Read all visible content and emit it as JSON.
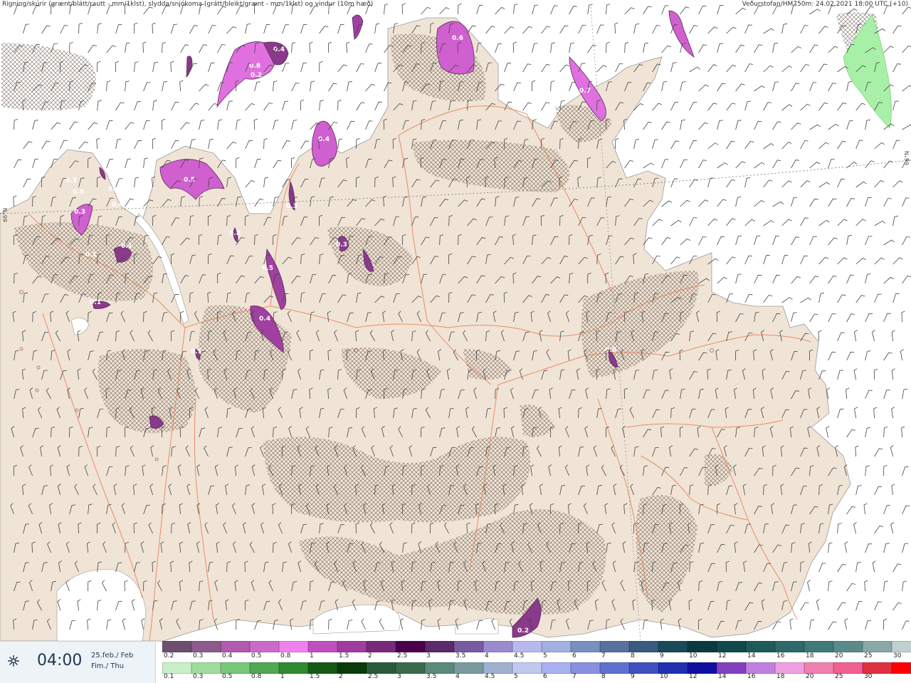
{
  "header": {
    "left": "Rigning/skúrir (grænt/blátt/rautt - mm/1klst), slydda/snjókoma (grátt/bleikt/grænt - mm/1klst) og vindur (10m hæð)",
    "right": "Veðurstofan/HM750m: 24.02.2021 18:00 UTC (+10)"
  },
  "lat_labels": [
    "66°N",
    "66°N"
  ],
  "time": {
    "value": "04:00",
    "date": "25.feb./ Feb",
    "day": "Fim./ Thu",
    "icon": "weather-station-icon"
  },
  "precip_values": [
    "0.8",
    "0.2",
    "0.4",
    "0.6",
    "0.7",
    "0.3",
    "0.5",
    "0.8",
    "0.6",
    "0.4",
    "0.4",
    "0.5",
    "0.3",
    "0.3",
    "0.1",
    "0.5",
    "0.4",
    "0.3",
    "0.1",
    "0.1",
    "0.5",
    "0.2",
    "0.1"
  ],
  "legend": {
    "snow_labels": [
      "0.2",
      "0.3",
      "0.4",
      "0.5",
      "0.8",
      "1",
      "1.5",
      "2",
      "2.5",
      "3",
      "3.5",
      "4",
      "4.5",
      "5",
      "6",
      "7",
      "8",
      "9",
      "10",
      "12",
      "14",
      "16",
      "18",
      "20",
      "25",
      "30"
    ],
    "snow_colors": [
      "#6e4e6e",
      "#8c5a8c",
      "#b05ab0",
      "#cc6acc",
      "#f080f0",
      "#c050c0",
      "#a03ca0",
      "#7a2a7a",
      "#4a004a",
      "#5a2a6a",
      "#7a5aa0",
      "#9a8ad0",
      "#b8b8f0",
      "#a0b0e0",
      "#7890c0",
      "#5a70a0",
      "#3a5a80",
      "#1a4a5a",
      "#0a3a40",
      "#0f4a4a",
      "#1e5a5a",
      "#2e6a6a",
      "#3e7a7a",
      "#5a8a8a",
      "#8aa8a8",
      "#c0cfcf",
      "#ffffff"
    ],
    "rain_labels": [
      "0.1",
      "0.3",
      "0.5",
      "0.8",
      "1",
      "1.5",
      "2",
      "2.5",
      "3",
      "3.5",
      "4",
      "4.5",
      "5",
      "6",
      "7",
      "8",
      "9",
      "10",
      "12",
      "14",
      "16",
      "18",
      "20",
      "25",
      "30"
    ],
    "rain_colors": [
      "#c8f0c8",
      "#a0dca0",
      "#78c878",
      "#50a850",
      "#2e8a2e",
      "#145a14",
      "#0a3a0a",
      "#2a5a3a",
      "#3a6a4a",
      "#5a8a7a",
      "#7a9aa0",
      "#a0b0d0",
      "#c0c8f0",
      "#a8b0f0",
      "#8890e0",
      "#6070d0",
      "#4050c0",
      "#2030b0",
      "#1010a0",
      "#8040c0",
      "#c080e0",
      "#f0a0e0",
      "#f080b0",
      "#f06090",
      "#e03040",
      "#ff0000"
    ]
  }
}
